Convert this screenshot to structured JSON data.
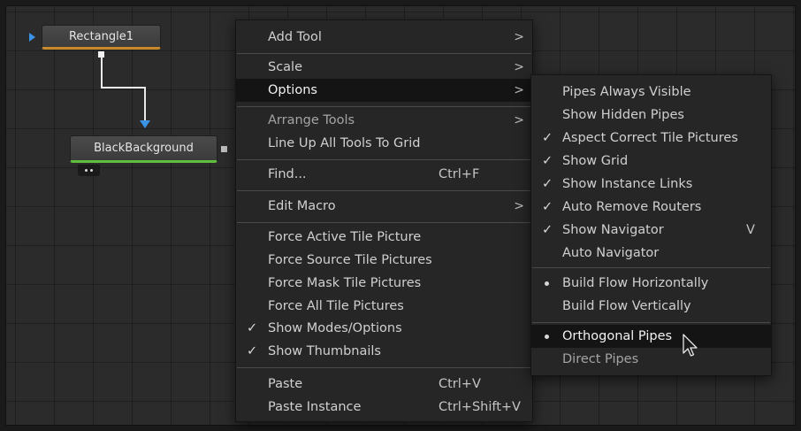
{
  "nodes": {
    "rectangle": "Rectangle1",
    "background": "BlackBackground"
  },
  "context_menu": {
    "add_tool": "Add Tool",
    "scale": "Scale",
    "options": "Options",
    "arrange_tools": "Arrange Tools",
    "line_up": "Line Up All Tools To Grid",
    "find": "Find...",
    "find_shortcut": "Ctrl+F",
    "edit_macro": "Edit Macro",
    "force_active": "Force Active Tile Picture",
    "force_source": "Force Source Tile Pictures",
    "force_mask": "Force Mask Tile Pictures",
    "force_all": "Force All Tile Pictures",
    "show_modes": "Show Modes/Options",
    "show_thumbnails": "Show Thumbnails",
    "paste": "Paste",
    "paste_shortcut": "Ctrl+V",
    "paste_instance": "Paste Instance",
    "paste_instance_shortcut": "Ctrl+Shift+V",
    "submenu_arrow": ">",
    "check_mark": "✓"
  },
  "options_submenu": {
    "pipes_always_visible": "Pipes Always Visible",
    "show_hidden_pipes": "Show Hidden Pipes",
    "aspect_correct": "Aspect Correct Tile Pictures",
    "show_grid": "Show Grid",
    "show_instance_links": "Show Instance Links",
    "auto_remove_routers": "Auto Remove Routers",
    "show_navigator": "Show Navigator",
    "show_navigator_shortcut": "V",
    "auto_navigator": "Auto Navigator",
    "build_horizontal": "Build Flow Horizontally",
    "build_vertical": "Build Flow Vertically",
    "orthogonal_pipes": "Orthogonal Pipes",
    "direct_pipes": "Direct Pipes"
  },
  "colors": {
    "canvas": "#2b2b2b",
    "menu_bg": "#262626",
    "highlight": "#141414",
    "input_arrow": "#3a93e6",
    "rect_node_accent": "#c7892a",
    "bg_node_accent": "#5fbf3c"
  }
}
